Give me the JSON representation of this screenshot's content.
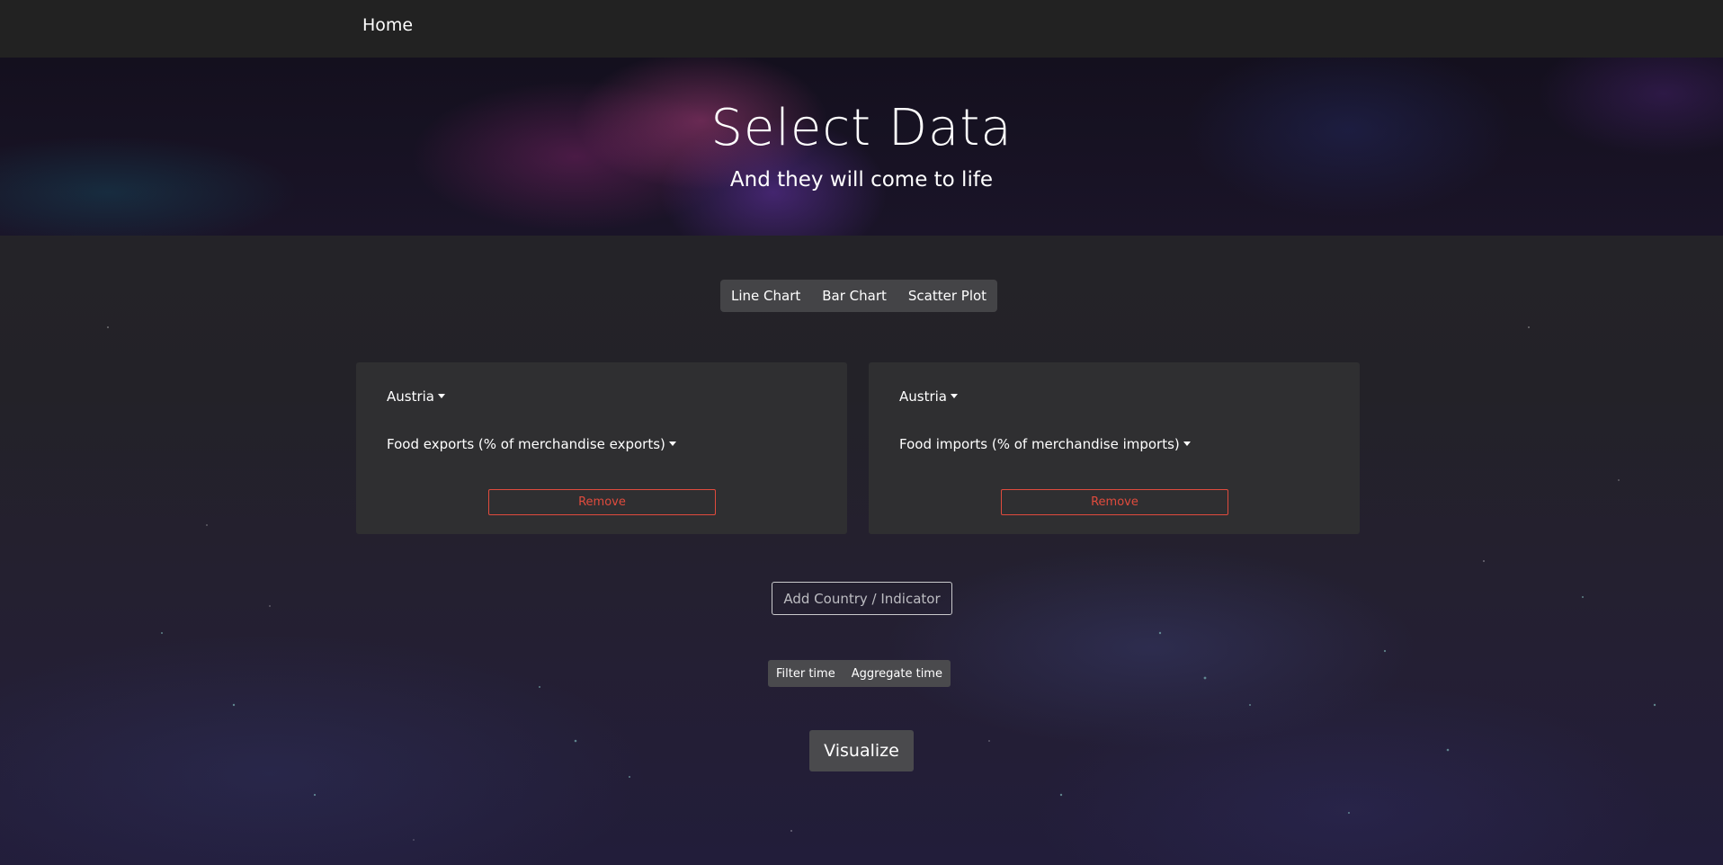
{
  "nav": {
    "home_label": "Home"
  },
  "hero": {
    "title": "Select Data",
    "subtitle": "And they will come to life"
  },
  "chart_types": [
    "Line Chart",
    "Bar Chart",
    "Scatter Plot"
  ],
  "cards": [
    {
      "country": "Austria",
      "indicator": "Food exports (% of merchandise exports)",
      "remove_label": "Remove"
    },
    {
      "country": "Austria",
      "indicator": "Food imports (% of merchandise imports)",
      "remove_label": "Remove"
    }
  ],
  "add_label": "Add Country / Indicator",
  "time_options": [
    "Filter time",
    "Aggregate time"
  ],
  "visualize_label": "Visualize",
  "colors": {
    "remove": "#e04b3d",
    "navbar": "#222222",
    "card": "#2f2f31"
  }
}
